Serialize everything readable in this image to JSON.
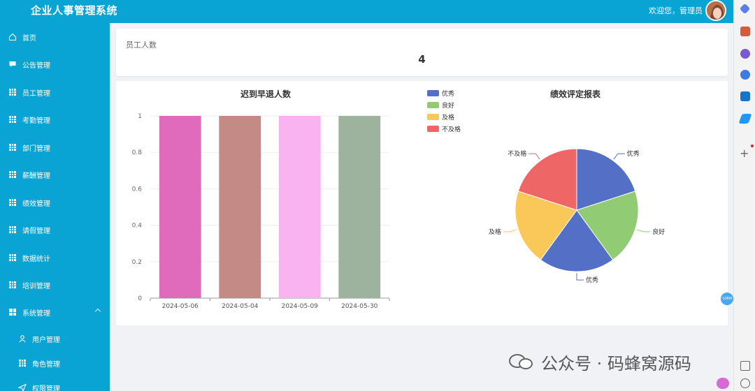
{
  "header": {
    "app_title": "企业人事管理系统",
    "welcome": "欢迎您，管理员"
  },
  "sidebar": {
    "items": [
      {
        "label": "首页",
        "icon": "home-icon"
      },
      {
        "label": "公告管理",
        "icon": "chat-icon"
      },
      {
        "label": "员工管理",
        "icon": "grid-icon"
      },
      {
        "label": "考勤管理",
        "icon": "grid-icon"
      },
      {
        "label": "部门管理",
        "icon": "grid-icon"
      },
      {
        "label": "薪酬管理",
        "icon": "grid-icon"
      },
      {
        "label": "绩效管理",
        "icon": "grid-icon"
      },
      {
        "label": "请假管理",
        "icon": "grid-icon"
      },
      {
        "label": "数据统计",
        "icon": "grid-icon"
      },
      {
        "label": "培训管理",
        "icon": "grid-icon"
      },
      {
        "label": "系统管理",
        "icon": "apps-icon"
      },
      {
        "label": "用户管理",
        "icon": "user-icon"
      },
      {
        "label": "角色管理",
        "icon": "grid-icon"
      },
      {
        "label": "权限管理",
        "icon": "send-icon"
      }
    ]
  },
  "stat_card": {
    "label": "员工人数",
    "value": "4"
  },
  "chart_data": [
    {
      "type": "bar",
      "title": "迟到早退人数",
      "categories": [
        "2024-05-06",
        "2024-05-04",
        "2024-05-09",
        "2024-05-30"
      ],
      "values": [
        1,
        1,
        1,
        1
      ],
      "colors": [
        "#e06bbd",
        "#c48a86",
        "#f8b3f0",
        "#9db39e"
      ],
      "ylim": [
        0,
        1
      ],
      "yticks": [
        "0",
        "0.2",
        "0.4",
        "0.6",
        "0.8",
        "1"
      ],
      "grid": true
    },
    {
      "type": "pie",
      "title": "绩效评定报表",
      "legend_position": "top-left",
      "legend": [
        "优秀",
        "良好",
        "及格",
        "不及格"
      ],
      "legend_colors": [
        "#5470c6",
        "#91cc75",
        "#fac858",
        "#ee6666"
      ],
      "slices": [
        {
          "label": "优秀",
          "value": 1,
          "color": "#5470c6"
        },
        {
          "label": "良好",
          "value": 1,
          "color": "#91cc75"
        },
        {
          "label": "优秀",
          "value": 1,
          "color": "#5470c6"
        },
        {
          "label": "及格",
          "value": 1,
          "color": "#fac858"
        },
        {
          "label": "不及格",
          "value": 1,
          "color": "#ee6666"
        }
      ]
    }
  ],
  "watermark": {
    "text": "公众号 · 码蜂窝源码"
  },
  "float_badge": "108M"
}
